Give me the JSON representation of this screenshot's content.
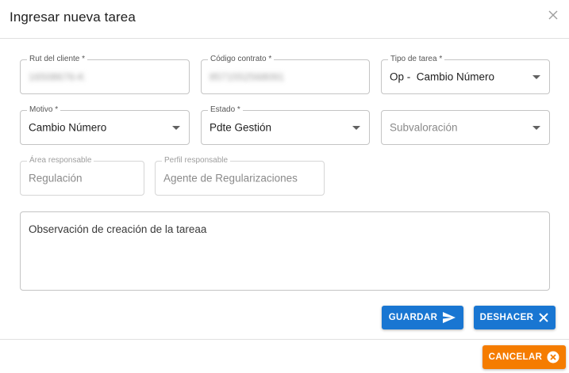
{
  "dialog": {
    "title": "Ingresar nueva tarea"
  },
  "form": {
    "rut_cliente": {
      "label": "Rut del cliente *",
      "value": "16508676-K"
    },
    "codigo_contrato": {
      "label": "Código contrato *",
      "value": "8571552568091"
    },
    "tipo_tarea": {
      "label": "Tipo de tarea *",
      "value": "Op -  Cambio Número"
    },
    "motivo": {
      "label": "Motivo *",
      "value": "Cambio Número"
    },
    "estado": {
      "label": "Estado *",
      "value": "Pdte Gestión"
    },
    "subvaloracion": {
      "placeholder": "Subvaloración"
    },
    "area_responsable": {
      "label": "Área responsable",
      "value": "Regulación"
    },
    "perfil_responsable": {
      "label": "Perfil responsable",
      "value": "Agente de Regularizaciones"
    },
    "observacion": {
      "placeholder": "Observación de creación de la tareaa"
    }
  },
  "actions": {
    "guardar_label": "GUARDAR",
    "deshacer_label": "DESHACER",
    "cancelar_label": "CANCELAR"
  },
  "colors": {
    "primary": "#1976d2",
    "cancel": "#f57c00"
  },
  "icons": {
    "close": "close-icon",
    "send": "send-icon",
    "undo": "x-icon",
    "cancel": "cancel-circle-icon",
    "dropdown": "caret-down-icon"
  }
}
